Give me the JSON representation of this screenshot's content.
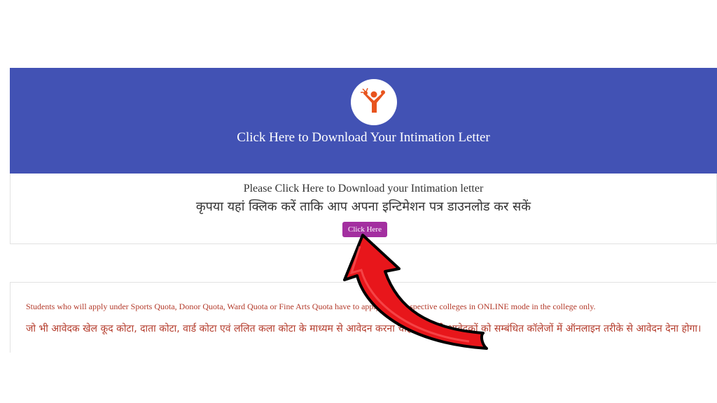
{
  "banner": {
    "title": "Click Here to Download Your Intimation Letter",
    "color": "#4252b4",
    "logo_icon": "person-raising-hand-logo-icon"
  },
  "card": {
    "line_en": "Please Click Here to Download your Intimation letter",
    "line_hi": "कृपया यहां क्लिक करें ताकि आप अपना इन्टिमेशन पत्र डाउनलोड कर सकें",
    "button_label": "Click Here",
    "button_color": "#a32fa0"
  },
  "notice": {
    "text_en": "Students who will apply under Sports Quota, Donor Quota, Ward Quota or Fine Arts Quota have to apply in the respective colleges in ONLINE mode in the college only.",
    "text_hi": "जो भी आवेदक खेल कूद कोटा, दाता कोटा, वार्ड कोटा एवं ललित कला कोटा के माध्यम से आवेदन करना चाहते हैं, वैसे आवेदकों को सम्बंधित कॉलेजों में ऑनलाइन तरीके से आवेदन देना होगा।",
    "color": "#b33a2a"
  },
  "overlay": {
    "arrow_icon": "red-curved-arrow-icon",
    "arrow_color": "#e8161b"
  }
}
